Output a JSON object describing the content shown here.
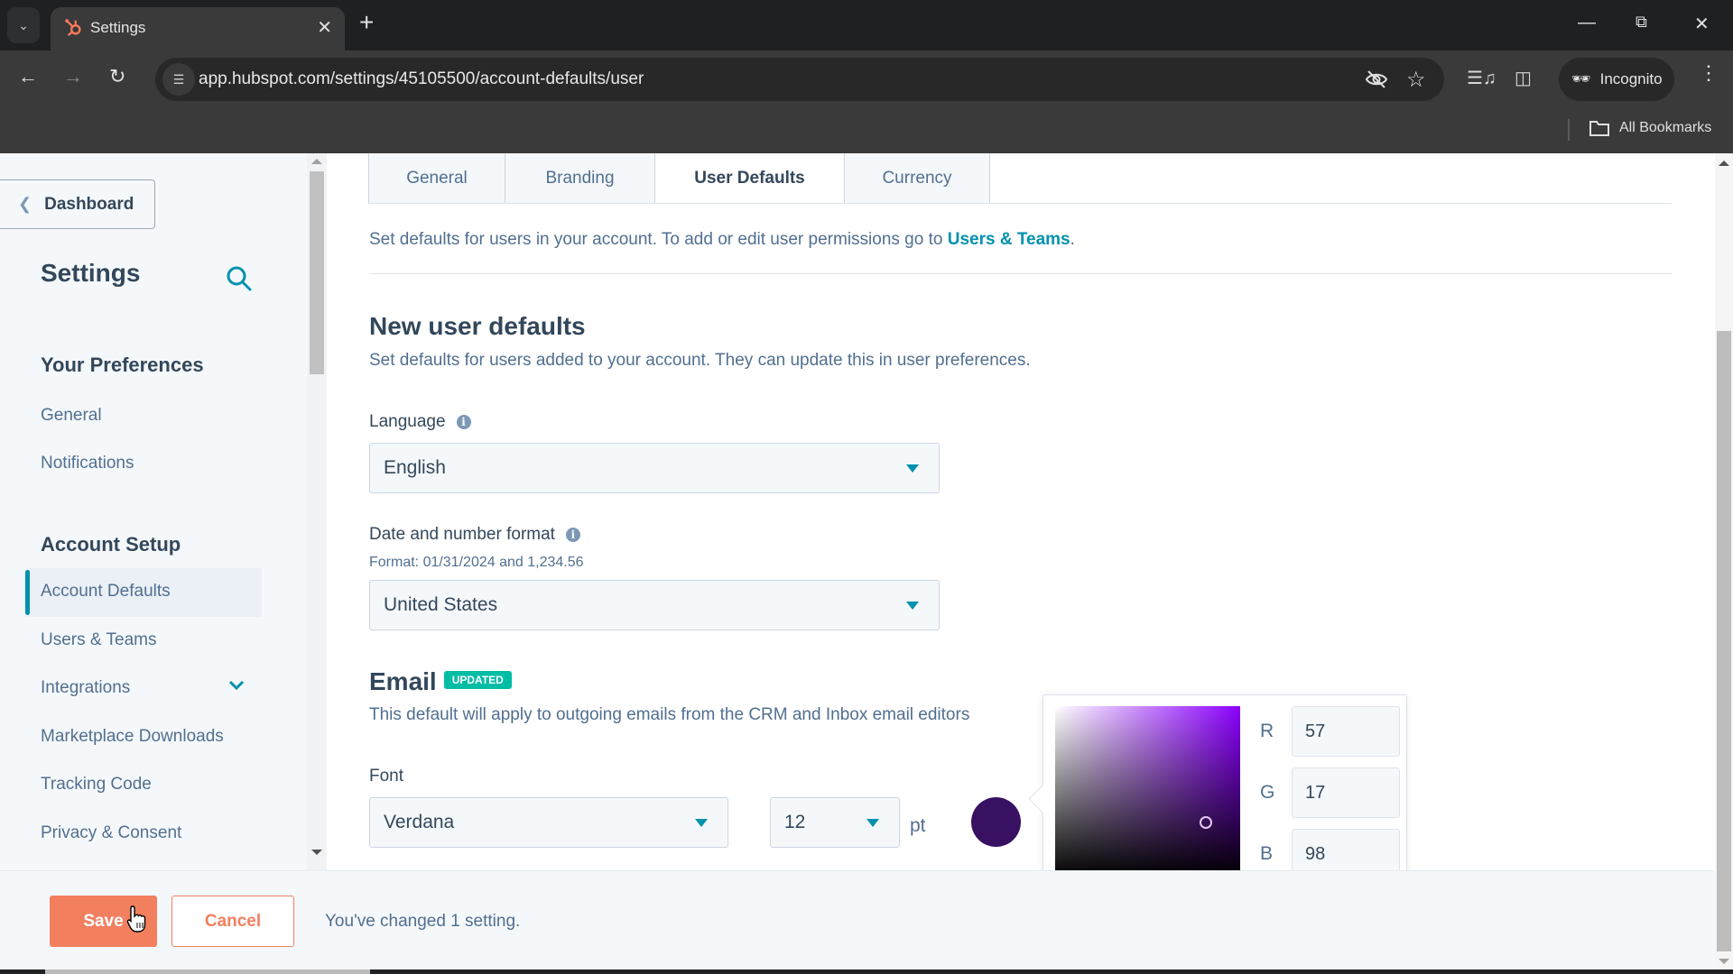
{
  "browser": {
    "tab_title": "Settings",
    "url": "app.hubspot.com/settings/45105500/account-defaults/user",
    "incognito_label": "Incognito",
    "bookmarks_label": "All Bookmarks",
    "icons": {
      "tab_search": "chevron-down-icon",
      "favicon": "hubspot-sprocket-icon",
      "close_tab": "close-icon",
      "new_tab": "plus-icon",
      "back": "arrow-left-icon",
      "forward": "arrow-right-icon",
      "reload": "reload-icon",
      "site_info": "tune-icon",
      "tracking": "eye-off-icon",
      "bookmark": "star-icon",
      "media": "playlist-icon",
      "side_panel": "side-panel-icon",
      "menu": "kebab-icon",
      "folder": "folder-icon"
    }
  },
  "sidebar": {
    "back_label": "Dashboard",
    "title": "Settings",
    "sections": [
      {
        "heading": "Your Preferences",
        "items": [
          {
            "label": "General"
          },
          {
            "label": "Notifications"
          }
        ]
      },
      {
        "heading": "Account Setup",
        "items": [
          {
            "label": "Account Defaults",
            "active": true
          },
          {
            "label": "Users & Teams"
          },
          {
            "label": "Integrations",
            "expandable": true
          },
          {
            "label": "Marketplace Downloads"
          },
          {
            "label": "Tracking Code"
          },
          {
            "label": "Privacy & Consent"
          }
        ]
      }
    ]
  },
  "main": {
    "tabs": [
      {
        "label": "General"
      },
      {
        "label": "Branding"
      },
      {
        "label": "User Defaults",
        "active": true
      },
      {
        "label": "Currency"
      }
    ],
    "intro_text": "Set defaults for users in your account. To add or edit user permissions go to ",
    "intro_link": "Users & Teams",
    "intro_end": ".",
    "new_user": {
      "heading": "New user defaults",
      "description": "Set defaults for users added to your account. They can update this in user preferences.",
      "language_label": "Language",
      "language_value": "English",
      "format_label": "Date and number format",
      "format_hint": "Format: 01/31/2024 and 1,234.56",
      "format_value": "United States"
    },
    "email": {
      "heading": "Email",
      "badge": "UPDATED",
      "description": "This default will apply to outgoing emails from the CRM and Inbox email editors",
      "font_label": "Font",
      "font_value": "Verdana",
      "size_value": "12",
      "size_unit": "pt",
      "color_hex": "#391162",
      "picker": {
        "r_label": "R",
        "r_value": "57",
        "g_label": "G",
        "g_value": "17",
        "b_label": "B",
        "b_value": "98"
      }
    }
  },
  "footer": {
    "save_label": "Save",
    "cancel_label": "Cancel",
    "status": "You've changed 1 setting."
  },
  "colors": {
    "accent": "#0091ae",
    "primary_button": "#f2805f",
    "badge": "#00bda5",
    "text_dark": "#33475b",
    "text_muted": "#516f90"
  }
}
